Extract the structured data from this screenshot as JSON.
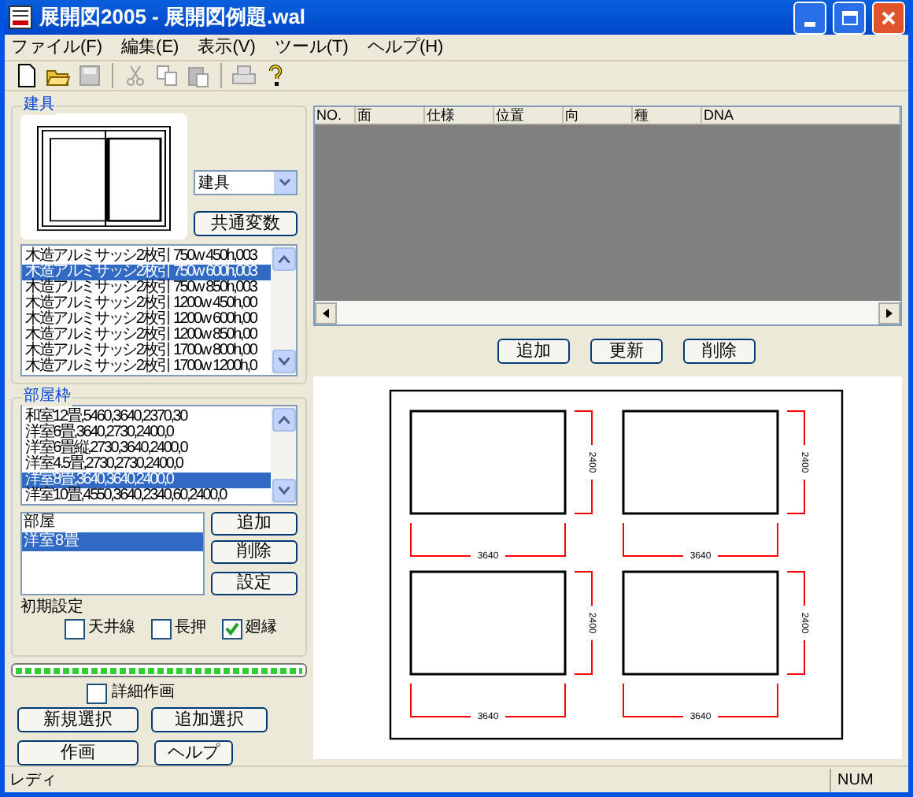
{
  "window": {
    "title": "展開図2005 - 展開図例題.wal"
  },
  "menu": [
    "ファイル(F)",
    "編集(E)",
    "表示(V)",
    "ツール(T)",
    "ヘルプ(H)"
  ],
  "toolbar": [
    {
      "kind": "new",
      "disabled": false
    },
    {
      "kind": "open",
      "disabled": false
    },
    {
      "kind": "save",
      "disabled": true
    },
    {
      "kind": "cut",
      "disabled": true
    },
    {
      "kind": "copy",
      "disabled": true
    },
    {
      "kind": "paste",
      "disabled": true
    },
    {
      "kind": "print",
      "disabled": true
    },
    {
      "kind": "help",
      "disabled": false
    }
  ],
  "fixture_group": {
    "title": "建具",
    "category_select": {
      "value": "建具"
    },
    "common_variables_button": "共通変数",
    "list": [
      {
        "label": "木造アルミサッシ2枚引 750w 450h,003",
        "selected": false
      },
      {
        "label": "木造アルミサッシ2枚引 750w 600h,003",
        "selected": true
      },
      {
        "label": "木造アルミサッシ2枚引 750w 850h,003",
        "selected": false
      },
      {
        "label": "木造アルミサッシ2枚引 1200w 450h,00",
        "selected": false
      },
      {
        "label": "木造アルミサッシ2枚引 1200w 600h,00",
        "selected": false
      },
      {
        "label": "木造アルミサッシ2枚引 1200w 850h,00",
        "selected": false
      },
      {
        "label": "木造アルミサッシ2枚引 1700w 800h,00",
        "selected": false
      },
      {
        "label": "木造アルミサッシ2枚引 1700w 1200h,0",
        "selected": false
      }
    ]
  },
  "room_frame_group": {
    "title": "部屋枠",
    "list": [
      {
        "label": "和室12畳,5460,3640,2370,30",
        "selected": false
      },
      {
        "label": "洋室6畳,3640,2730,2400,0",
        "selected": false
      },
      {
        "label": "洋室6畳縦,2730,3640,2400,0",
        "selected": false
      },
      {
        "label": "洋室4.5畳,2730,2730,2400,0",
        "selected": false
      },
      {
        "label": "洋室8畳,3640,3640,2400,0",
        "selected": true
      },
      {
        "label": "洋室10畳,4550,3640,2340,60,2400,0",
        "selected": false
      }
    ]
  },
  "rooms": {
    "list": [
      {
        "label": "部屋",
        "selected": false
      },
      {
        "label": "洋室8畳",
        "selected": true
      }
    ],
    "add_button": "追加",
    "delete_button": "削除",
    "settings_button": "設定"
  },
  "initial_settings": {
    "label": "初期設定",
    "checkboxes": [
      {
        "label": "天井線",
        "checked": false
      },
      {
        "label": "長押",
        "checked": false
      },
      {
        "label": "廻縁",
        "checked": true
      }
    ]
  },
  "progress": {
    "level": 1
  },
  "detail_drawing": {
    "label": "詳細作画",
    "checked": false
  },
  "bottom_buttons": [
    {
      "label": "新規選択"
    },
    {
      "label": "追加選択"
    },
    {
      "label": "作画"
    },
    {
      "label": "ヘルプ"
    }
  ],
  "table": {
    "columns": [
      "NO.",
      "面",
      "仕様",
      "位置",
      "向",
      "種",
      "DNA"
    ]
  },
  "table_buttons": [
    "追加",
    "更新",
    "削除"
  ],
  "elevations": [
    {
      "width_label": "3640",
      "height_label": "2400"
    },
    {
      "width_label": "3640",
      "height_label": "2400"
    },
    {
      "width_label": "3640",
      "height_label": "2400"
    },
    {
      "width_label": "3640",
      "height_label": "2400"
    }
  ],
  "status_bar": {
    "message": "レディ",
    "num": "NUM"
  }
}
